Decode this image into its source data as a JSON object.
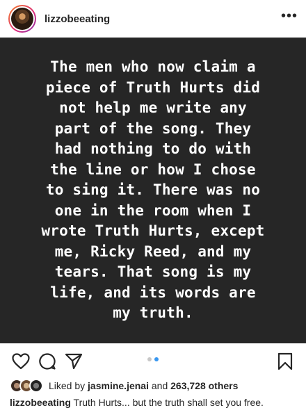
{
  "header": {
    "username": "lizzobeeating",
    "more_icon": "more-horizontal-icon"
  },
  "post": {
    "text": "The men who now claim a\npiece of Truth Hurts did\nnot help me write any\npart of the song.  They\nhad nothing to do with\nthe line or how I chose\nto sing it. There was no\none in the room when I\nwrote Truth Hurts, except\nme, Ricky Reed, and my\ntears.  That song is my\nlife, and its words are\nmy truth.",
    "background_color": "#262626",
    "text_color": "#ffffff"
  },
  "actions": {
    "icons": [
      "heart-icon",
      "comment-icon",
      "share-icon",
      "bookmark-icon"
    ],
    "carousel_dots": 2,
    "active_dot": 1,
    "active_dot_color": "#3897f0"
  },
  "likes": {
    "prefix": "Liked by",
    "user": "jasmine.jenai",
    "connector": "and",
    "count": "263,728 others"
  },
  "caption": {
    "username": "lizzobeeating",
    "text": "Truth Hurts... but the truth shall set you free."
  }
}
